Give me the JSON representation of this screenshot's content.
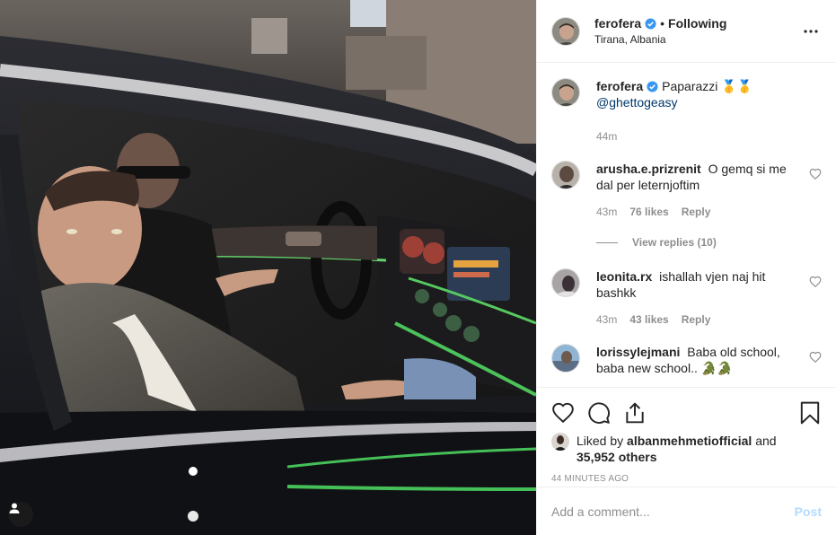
{
  "post": {
    "username": "ferofera",
    "follow_separator": "•",
    "follow_label": "Following",
    "location": "Tirana, Albania",
    "caption_user": "ferofera",
    "caption_text": "Paparazzi 🥇🥇",
    "caption_mention": "@ghettogeasy",
    "caption_time": "44m"
  },
  "comments": [
    {
      "user": "arusha.e.prizrenit",
      "text": "O gemq si me dal per leternjoftim",
      "time": "43m",
      "likes": "76 likes",
      "reply": "Reply",
      "view_replies": "View replies (10)"
    },
    {
      "user": "leonita.rx",
      "text": "ishallah vjen naj hit bashkk",
      "time": "43m",
      "likes": "43 likes",
      "reply": "Reply"
    },
    {
      "user": "lorissylejmani",
      "text": "Baba old school, baba new school.. 🐊🐊"
    }
  ],
  "likes": {
    "prefix": "Liked by",
    "user": "albanmehmetiofficial",
    "and": "and",
    "others": "35,952 others"
  },
  "timestamp": "44 MINUTES AGO",
  "add_comment": {
    "placeholder": "Add a comment...",
    "post_label": "Post"
  },
  "colors": {
    "verified": "#3897f0",
    "link": "#00376b",
    "muted": "#8e8e8e",
    "post_disabled": "#b3dbff"
  }
}
